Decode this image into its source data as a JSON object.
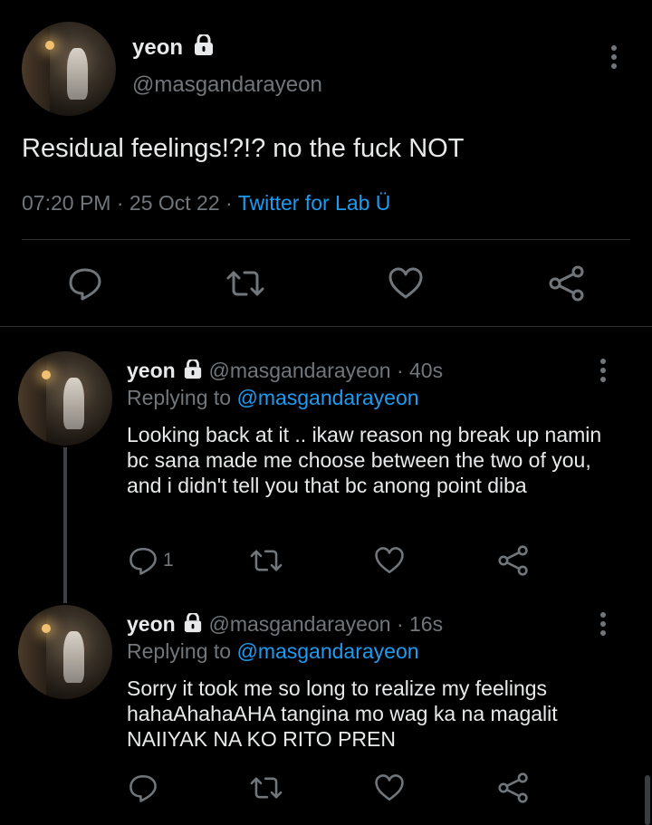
{
  "main_tweet": {
    "display_name": "yeon",
    "handle": "@masgandarayeon",
    "text": "Residual feelings!?!? no the fuck NOT",
    "time": "07:20 PM",
    "date": "25 Oct 22",
    "source": "Twitter for Lab Ü",
    "separator": "·"
  },
  "replies": [
    {
      "display_name": "yeon",
      "handle": "@masgandarayeon",
      "age": "40s",
      "replying_prefix": "Replying to",
      "replying_to": "@masgandarayeon",
      "text": "Looking back at it .. ikaw reason ng break up namin bc sana made me choose between the two of you, and i didn't tell you that bc anong point diba",
      "reply_count": "1"
    },
    {
      "display_name": "yeon",
      "handle": "@masgandarayeon",
      "age": "16s",
      "replying_prefix": "Replying to",
      "replying_to": "@masgandarayeon",
      "text": "Sorry it took me so long to realize my feelings hahaAhahaAHA tangina mo wag ka na magalit NAIIYAK NA KO RITO PREN",
      "reply_count": ""
    }
  ],
  "icons": [
    "reply-icon",
    "retweet-icon",
    "like-icon",
    "share-icon",
    "lock-icon",
    "more-icon"
  ],
  "colors": {
    "background": "#000000",
    "text": "#e7e9ea",
    "muted": "#71767b",
    "link": "#1d9bf0"
  }
}
